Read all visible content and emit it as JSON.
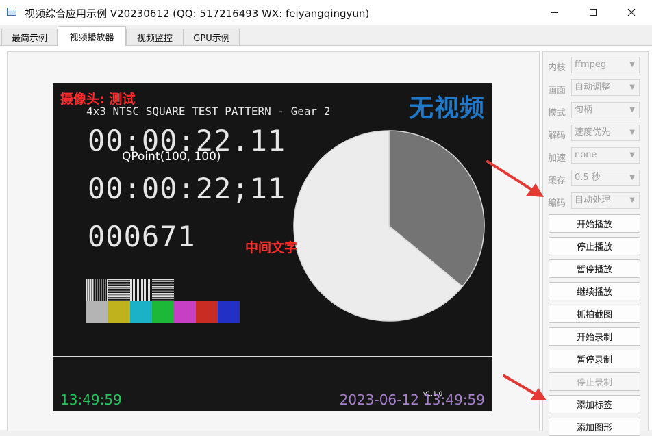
{
  "window": {
    "title": "视频综合应用示例 V20230612 (QQ: 517216493 WX: feiyangqingyun)",
    "minimize_icon": "minimize-icon",
    "maximize_icon": "maximize-icon",
    "close_icon": "close-icon"
  },
  "tabs": [
    {
      "label": "最简示例",
      "active": false
    },
    {
      "label": "视频播放器",
      "active": true
    },
    {
      "label": "视频监控",
      "active": false
    },
    {
      "label": "GPU示例",
      "active": false
    }
  ],
  "video": {
    "camera_label": "摄像头: 测试",
    "no_video": "无视频",
    "pattern_title": "4x3 NTSC SQUARE TEST PATTERN - Gear 2",
    "timecode1": "00:00:22.11",
    "timecode2": "00:00:22;11",
    "frame": "000671",
    "qpoint": "QPoint(100, 100)",
    "middle_text": "中间文字",
    "time_left": "13:49:59",
    "time_right": "2023-06-12 13:49:59",
    "tiny_text": "v1.1.0",
    "pie_fractions": [
      0.36,
      0.64
    ],
    "pie_colors": [
      "#747474",
      "#ececec"
    ],
    "bar_colors": [
      "#b4b4b4",
      "#c0b21c",
      "#1bb2c8",
      "#1db838",
      "#c63fc4",
      "#c92c22",
      "#2330c6"
    ],
    "accent_colors": {
      "label_red": "#ff2a2a",
      "no_video_blue": "#1f78c8",
      "time_green": "#22c55e",
      "time_purple": "#a57fc9"
    }
  },
  "controls": {
    "fields": [
      {
        "label": "内核",
        "value": "ffmpeg"
      },
      {
        "label": "画面",
        "value": "自动调整"
      },
      {
        "label": "模式",
        "value": "句柄"
      },
      {
        "label": "解码",
        "value": "速度优先"
      },
      {
        "label": "加速",
        "value": "none"
      },
      {
        "label": "缓存",
        "value": "0.5 秒"
      },
      {
        "label": "编码",
        "value": "自动处理"
      }
    ],
    "buttons": [
      {
        "label": "开始播放",
        "enabled": true
      },
      {
        "label": "停止播放",
        "enabled": true
      },
      {
        "label": "暂停播放",
        "enabled": true
      },
      {
        "label": "继续播放",
        "enabled": true
      },
      {
        "label": "抓拍截图",
        "enabled": true
      },
      {
        "label": "开始录制",
        "enabled": true
      },
      {
        "label": "暂停录制",
        "enabled": true
      },
      {
        "label": "停止录制",
        "enabled": false
      },
      {
        "label": "添加标签",
        "enabled": true
      },
      {
        "label": "添加图形",
        "enabled": true
      }
    ]
  }
}
